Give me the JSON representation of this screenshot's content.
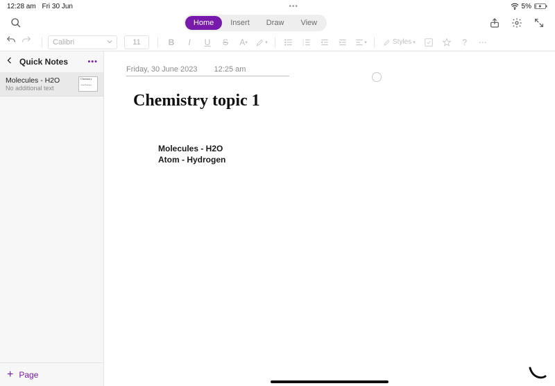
{
  "status": {
    "time": "12:28 am",
    "date": "Fri 30 Jun",
    "battery": "5%"
  },
  "tabs": {
    "home": "Home",
    "insert": "Insert",
    "draw": "Draw",
    "view": "View"
  },
  "ribbon": {
    "font": "Calibri",
    "size": "11",
    "styles_label": "Styles"
  },
  "sidebar": {
    "title": "Quick Notes",
    "items": [
      {
        "title": "Molecules - H2O",
        "sub": "No additional text",
        "thumb_main": "Chemistry",
        "thumb_small": "Atom Hydrogen"
      }
    ],
    "footer": "Page"
  },
  "page": {
    "date_long": "Friday, 30 June 2023",
    "time": "12:25 am",
    "hand_title": "Chemistry topic 1",
    "body": {
      "l1": "Molecules - H2O",
      "l2": "Atom - Hydrogen"
    }
  }
}
